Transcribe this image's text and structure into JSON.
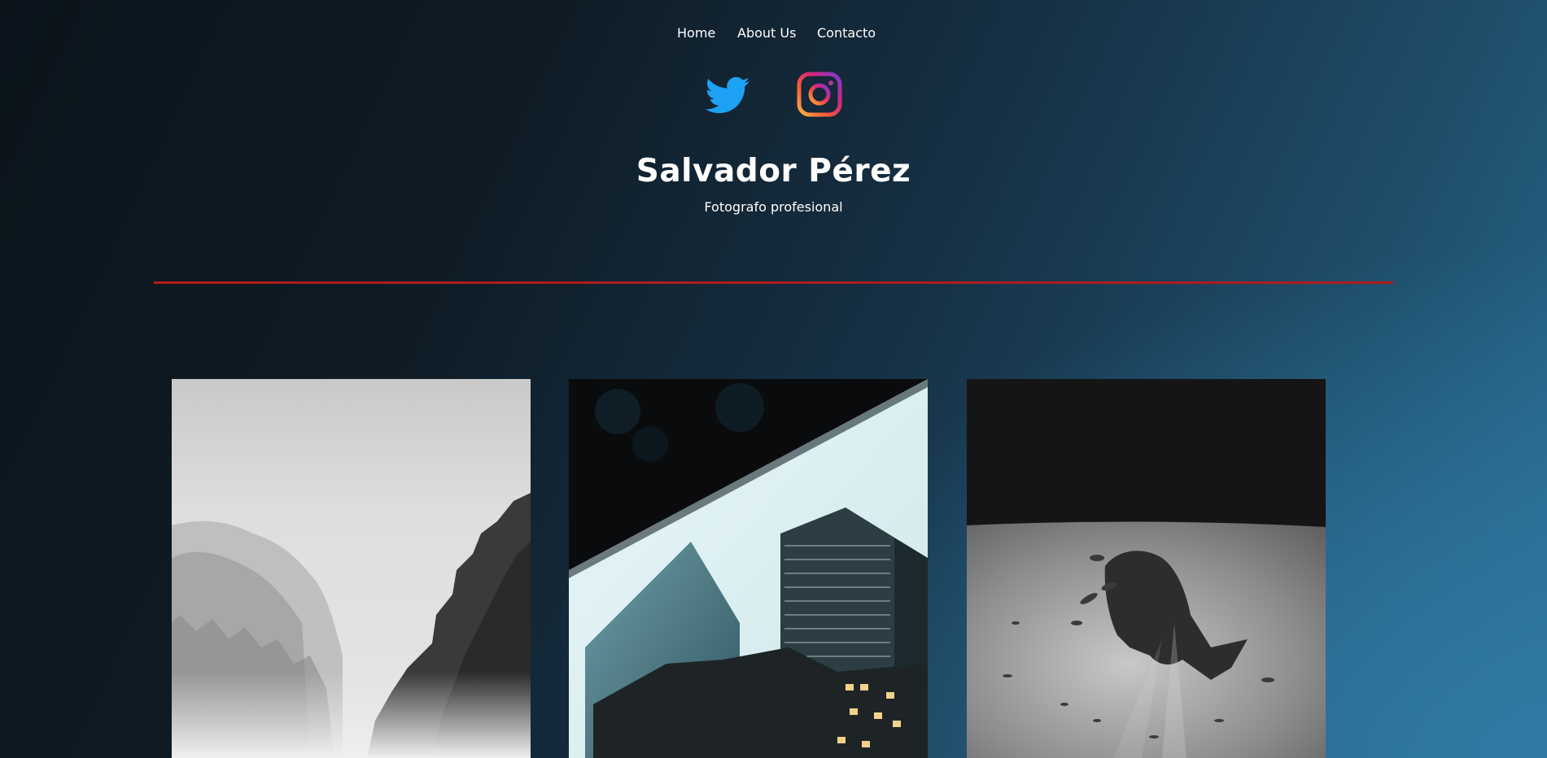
{
  "nav": {
    "items": [
      {
        "label": "Home"
      },
      {
        "label": "About Us"
      },
      {
        "label": "Contacto"
      }
    ]
  },
  "social": {
    "twitter": {
      "icon": "twitter-icon",
      "color": "#1da1f2"
    },
    "instagram": {
      "icon": "instagram-icon"
    }
  },
  "header": {
    "title": "Salvador Pérez",
    "subtitle": "Fotografo profesional"
  },
  "divider": {
    "color": "#b01c1c"
  },
  "gallery": {
    "photos": [
      {
        "subject": "foggy forest trees"
      },
      {
        "subject": "skyscrapers looking up"
      },
      {
        "subject": "whale shark underwater"
      }
    ]
  }
}
